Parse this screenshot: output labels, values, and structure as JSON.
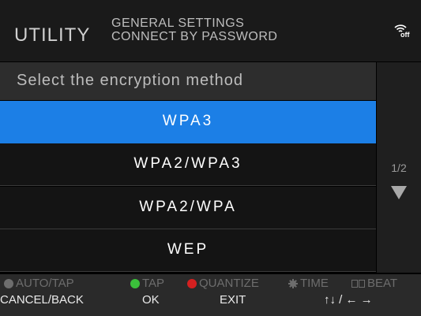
{
  "header": {
    "mode": "UTILITY",
    "path_line1": "GENERAL SETTINGS",
    "path_line2": "CONNECT BY PASSWORD",
    "wifi_status": "off",
    "wifi_icon": "wifi-icon"
  },
  "prompt": "Select the encryption method",
  "options": [
    {
      "label": "WPA3",
      "selected": true
    },
    {
      "label": "WPA2/WPA3",
      "selected": false
    },
    {
      "label": "WPA2/WPA",
      "selected": false
    },
    {
      "label": "WEP",
      "selected": false
    }
  ],
  "pager": {
    "text": "1/2",
    "icon": "triangle-down-icon"
  },
  "footer": {
    "row1": [
      "AUTO/TAP",
      "TAP",
      "QUANTIZE",
      "TIME",
      "BEAT"
    ],
    "row2": [
      "CANCEL/BACK",
      "OK",
      "EXIT",
      "↑↓ / ← →"
    ]
  },
  "colors": {
    "selected": "#1c7fe6",
    "tap_green": "#3bbf3b",
    "quantize_red": "#d42020"
  }
}
